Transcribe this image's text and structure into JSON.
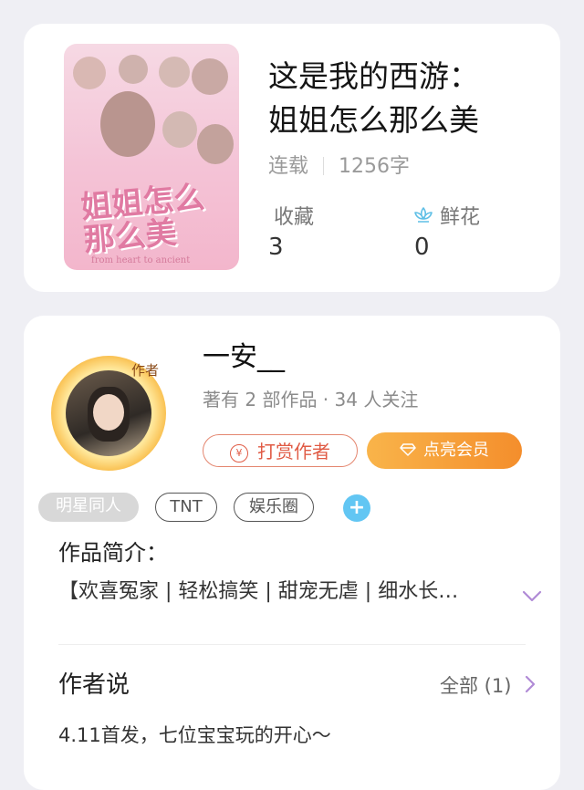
{
  "book": {
    "title_line1": "这是我的西游：",
    "title_line2": "姐姐怎么那么美",
    "status": "连载",
    "word_count": "1256字",
    "favorites_label": "收藏",
    "favorites_value": "3",
    "flowers_label": "鲜花",
    "flowers_value": "0",
    "cover_text_line1": "姐姐怎么",
    "cover_text_line2": "那么美",
    "cover_small_text": "from heart to ancient"
  },
  "author": {
    "badge": "作者",
    "name": "一安__",
    "info": "著有 2 部作品 · 34 人关注",
    "reward_button": "打赏作者",
    "reward_icon": "¥",
    "vip_button": "点亮会员",
    "tags": [
      "明星同人",
      "TNT",
      "娱乐圈"
    ],
    "add_tag": "+",
    "intro_label": "作品简介：",
    "intro_text": "【欢喜冤家 | 轻松搞笑 | 甜宠无虐 | 细水长…",
    "author_say_label": "作者说",
    "all_label": "全部 (1)",
    "say_text": "4.11首发，七位宝宝玩的开心～"
  },
  "colors": {
    "accent_orange": "#f48e2c",
    "reward_red": "#e05b45",
    "plus_blue": "#62c6f3",
    "flower_blue": "#5fbfe6"
  }
}
